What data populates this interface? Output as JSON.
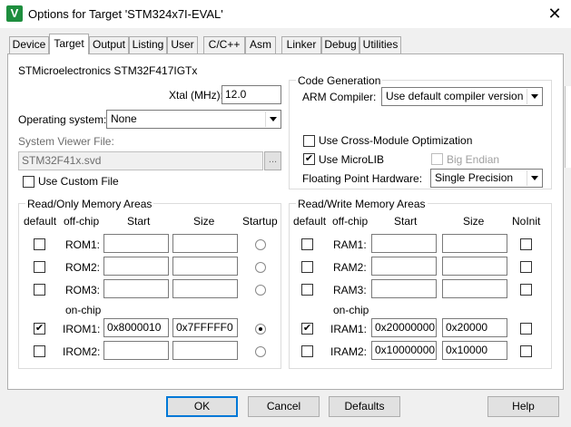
{
  "window": {
    "title": "Options for Target 'STM324x7I-EVAL'",
    "icon_text": "V"
  },
  "tabs": [
    {
      "label": "Device"
    },
    {
      "label": "Target"
    },
    {
      "label": "Output"
    },
    {
      "label": "Listing"
    },
    {
      "label": "User"
    },
    {
      "label": "C/C++"
    },
    {
      "label": "Asm"
    },
    {
      "label": "Linker"
    },
    {
      "label": "Debug"
    },
    {
      "label": "Utilities"
    }
  ],
  "device_name": "STMicroelectronics STM32F417IGTx",
  "xtal": {
    "label": "Xtal (MHz):",
    "value": "12.0"
  },
  "os": {
    "label": "Operating system:",
    "value": "None"
  },
  "svd": {
    "label": "System Viewer File:",
    "value": "STM32F41x.svd",
    "browse_label": "..."
  },
  "custom_file": {
    "label": "Use Custom File",
    "checked": false
  },
  "codegen": {
    "title": "Code Generation",
    "compiler_label": "ARM Compiler:",
    "compiler_value": "Use default compiler version",
    "cross_module": {
      "label": "Use Cross-Module Optimization",
      "checked": false
    },
    "microlib": {
      "label": "Use MicroLIB",
      "checked": true
    },
    "big_endian": {
      "label": "Big Endian",
      "checked": false
    },
    "fpu_label": "Floating Point Hardware:",
    "fpu_value": "Single Precision"
  },
  "rom_group": {
    "title": "Read/Only Memory Areas",
    "headers": {
      "default": "default",
      "offchip": "off-chip",
      "start": "Start",
      "size": "Size",
      "extra": "Startup"
    },
    "onchip_label": "on-chip",
    "rows": [
      {
        "label": "ROM1:",
        "default": false,
        "start": "",
        "size": "",
        "startup": false
      },
      {
        "label": "ROM2:",
        "default": false,
        "start": "",
        "size": "",
        "startup": false
      },
      {
        "label": "ROM3:",
        "default": false,
        "start": "",
        "size": "",
        "startup": false
      },
      {
        "label": "IROM1:",
        "default": true,
        "start": "0x8000010",
        "size": "0x7FFFFF0",
        "startup": true
      },
      {
        "label": "IROM2:",
        "default": false,
        "start": "",
        "size": "",
        "startup": false
      }
    ]
  },
  "ram_group": {
    "title": "Read/Write Memory Areas",
    "headers": {
      "default": "default",
      "offchip": "off-chip",
      "start": "Start",
      "size": "Size",
      "extra": "NoInit"
    },
    "onchip_label": "on-chip",
    "rows": [
      {
        "label": "RAM1:",
        "default": false,
        "start": "",
        "size": "",
        "noinit": false
      },
      {
        "label": "RAM2:",
        "default": false,
        "start": "",
        "size": "",
        "noinit": false
      },
      {
        "label": "RAM3:",
        "default": false,
        "start": "",
        "size": "",
        "noinit": false
      },
      {
        "label": "IRAM1:",
        "default": true,
        "start": "0x20000000",
        "size": "0x20000",
        "noinit": false
      },
      {
        "label": "IRAM2:",
        "default": false,
        "start": "0x10000000",
        "size": "0x10000",
        "noinit": false
      }
    ]
  },
  "buttons": {
    "ok": "OK",
    "cancel": "Cancel",
    "defaults": "Defaults",
    "help": "Help"
  },
  "icons": {
    "check": "✔",
    "close": "✕"
  },
  "colors": {
    "accent": "#0078d7",
    "app_icon": "#1e8e3e"
  }
}
